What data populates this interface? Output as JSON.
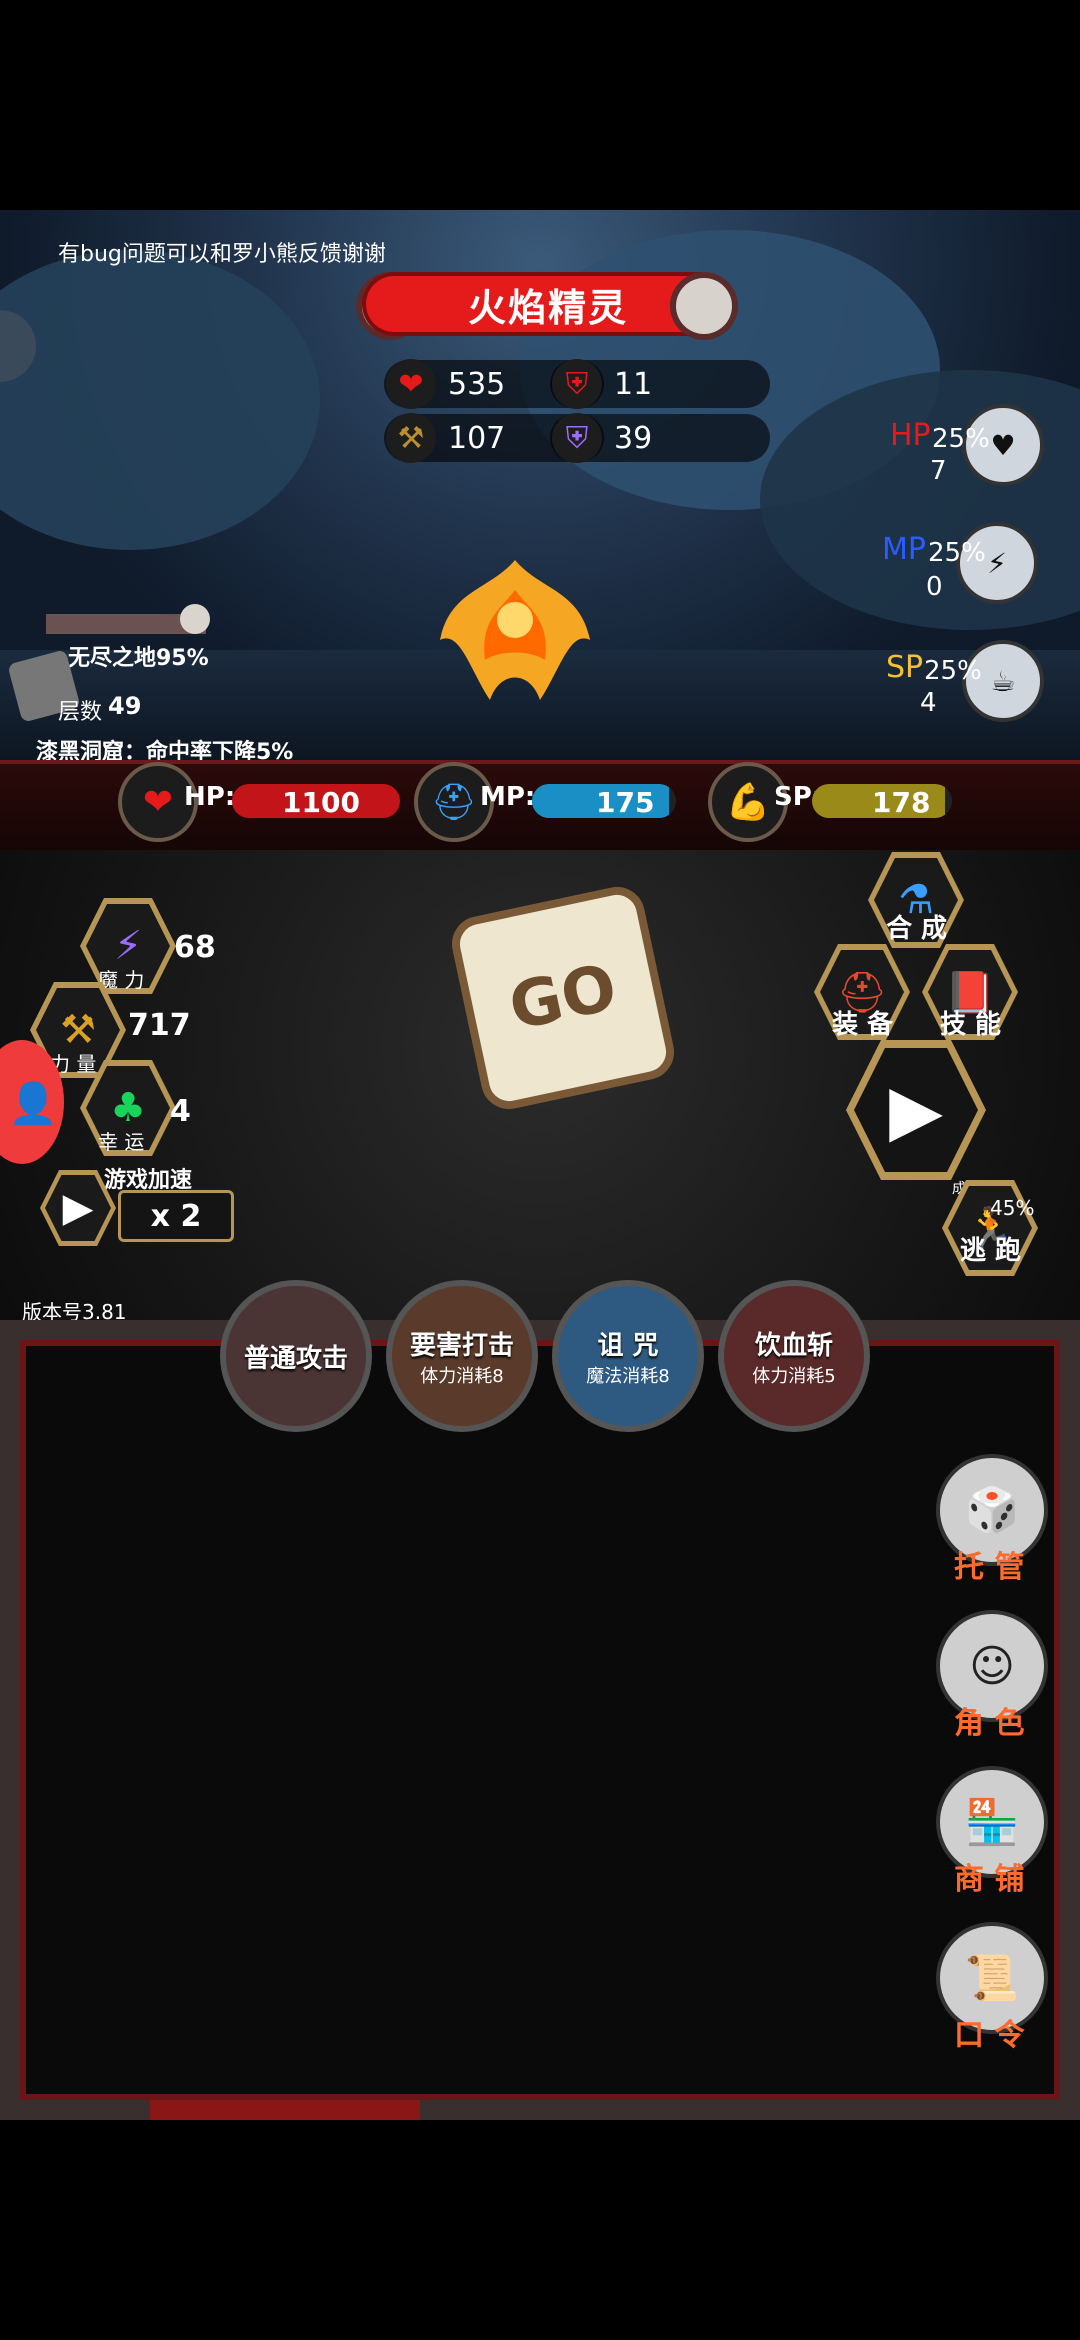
{
  "notice": "有bug问题可以和罗小熊反馈谢谢",
  "enemy": {
    "name": "火焰精灵",
    "hp": "535",
    "defense": "11",
    "attack": "107",
    "magic_defense": "39"
  },
  "potions": {
    "hp": {
      "label": "HP",
      "percent": "25%",
      "count": "7"
    },
    "mp": {
      "label": "MP",
      "percent": "25%",
      "count": "0"
    },
    "sp": {
      "label": "SP",
      "percent": "25%",
      "count": "4"
    }
  },
  "location": {
    "zone": "无尽之地95%",
    "floor_label": "层数",
    "floor": "49",
    "effect": "漆黑洞窟：命中率下降5%"
  },
  "player_bars": {
    "hp": {
      "label": "HP:",
      "value": "1100",
      "fill": 1.0,
      "color": "#c3141a"
    },
    "mp": {
      "label": "MP:",
      "value": "175",
      "fill": 0.95,
      "color": "#1a8fc5"
    },
    "sp": {
      "label": "SP:",
      "value": "178",
      "fill": 0.95,
      "color": "#9a8a1a"
    }
  },
  "attributes": [
    {
      "label": "魔 力",
      "value": "68",
      "icon": "lightning-icon"
    },
    {
      "label": "力 量",
      "value": "717",
      "icon": "axe-icon"
    },
    {
      "label": "幸 运",
      "value": "4",
      "icon": "clover-icon"
    }
  ],
  "speed": {
    "label": "游戏加速",
    "multiplier": "x 2"
  },
  "dice_label": "GO",
  "menu": {
    "synthesize": "合 成",
    "equip": "装 备",
    "skills": "技 能"
  },
  "escape": {
    "rate_label": "成功率:",
    "rate": "45%",
    "label": "逃 跑"
  },
  "version": "版本号3.81",
  "skills": [
    {
      "name": "普通攻击",
      "cost": ""
    },
    {
      "name": "要害打击",
      "cost": "体力消耗8"
    },
    {
      "name": "诅 咒",
      "cost": "魔法消耗8"
    },
    {
      "name": "饮血斩",
      "cost": "体力消耗5"
    }
  ],
  "side_buttons": [
    {
      "label": "托 管",
      "icon": "dice-icon"
    },
    {
      "label": "角 色",
      "icon": "hood-icon"
    },
    {
      "label": "商 铺",
      "icon": "shop-icon"
    },
    {
      "label": "口 令",
      "icon": "scroll-icon"
    }
  ],
  "colors": {
    "accent_red": "#e51a1a",
    "gold": "#b79655",
    "orange": "#ff6b2d"
  }
}
